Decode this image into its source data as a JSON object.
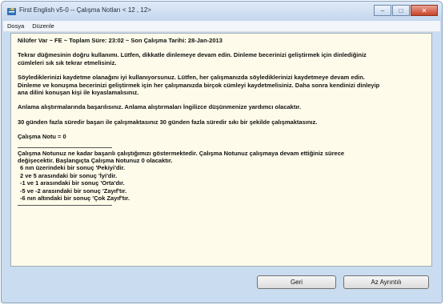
{
  "window": {
    "title": "First English v5-0  --  Çalışma Notları < 12 , 12>",
    "minimize": "–",
    "maximize": "□",
    "close": "✕"
  },
  "menu": [
    "Dosya",
    "Düzenle"
  ],
  "header": "Nilüfer Var  ~  FE  ~  Toplam Süre: 23:02  ~  Son Çalışma Tarihi: 28-Jan-2013",
  "paragraphs": {
    "listening": [
      "Tekrar düğmesinin doğru kullanımı. Lütfen, dikkatle dinlemeye devam edin.  Dinleme becerinizi geliştirmek için dinlediğiniz",
      "cümleleri sık sık tekrar etmelisiniz."
    ],
    "recording": [
      "Söylediklerinizi kaydetme olanağını iyi kullanıyorsunuz. Lütfen, her çalışmanızda söylediklerinizi kaydetmeye devam edin.",
      "Dinleme ve konuşma becerinizi geliştirmek için her çalışmanızda birçok cümleyi kaydetmelisiniz. Daha sonra kendinizi dinleyip",
      "ana dilini konuşan kişi ile kıyaslamalısınız."
    ],
    "comprehension": "Anlama alıştırmalarında başarılısınız.  Anlama alıştırmaları İngilizce düşünmenize yardımcı olacaktır.",
    "days": "30 günden fazla süredir başarı ile çalışmaktasınız  30 günden fazla süredir sıkı bir şekilde çalışmaktasınız.",
    "grade": "Çalışma Notu = 0",
    "explanation": [
      "Çalışma Notunuz ne kadar başarılı çalıştığımızı göstermektedir.  Çalışma Notunuz çalışmaya devam ettiğiniz sürece",
      "değişecektir.  Başlangıçta Çalışma Notunuz  0  olacaktır."
    ],
    "scale": [
      " 6 nın üzerindeki bir sonuç 'Pekiyi'dir.",
      " 2 ve 5 arasındaki bir sonuç 'İyi'dir.",
      " -1 ve 1 arasındaki bir sonuç 'Orta'dır.",
      " -5 ve -2 arasındaki bir sonuç 'Zayıf'tır.",
      " -6 nın altındaki bir sonuç 'Çok Zayıf'tır."
    ]
  },
  "buttons": {
    "back": "Geri",
    "more": "Az Ayrıntılı"
  },
  "colors": {
    "content_bg": "#fffbea",
    "frame": "#c9dcf0"
  }
}
